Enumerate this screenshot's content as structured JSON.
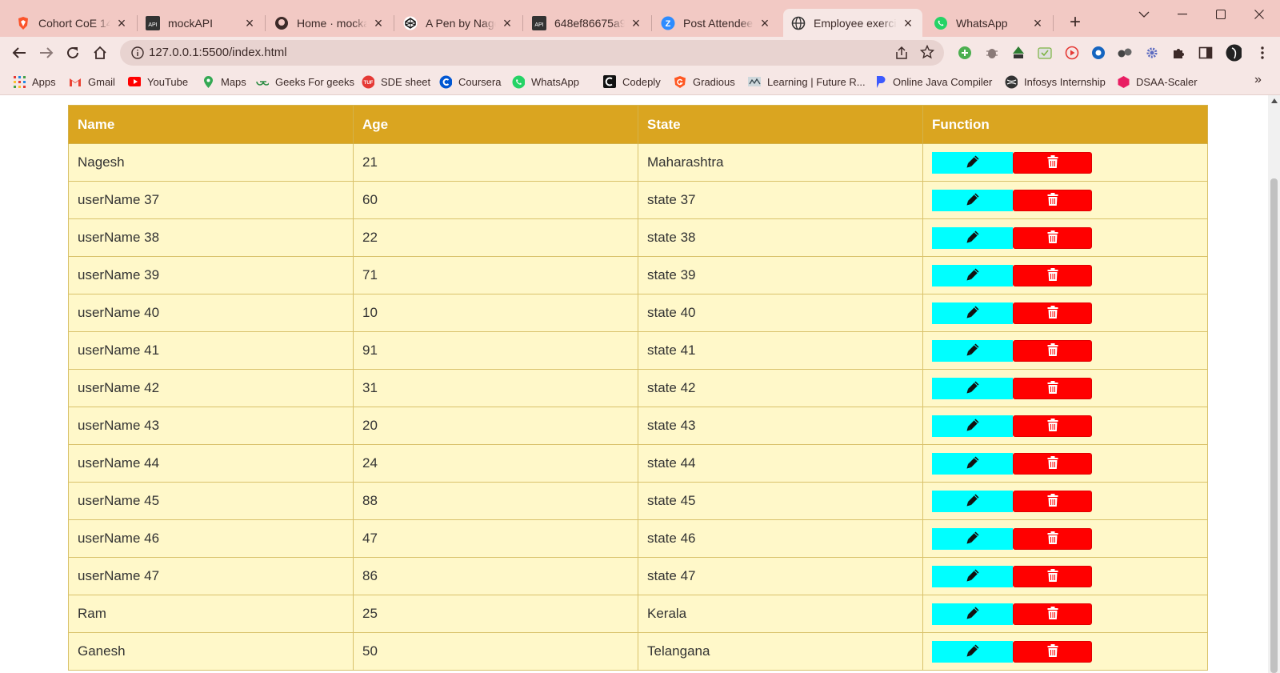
{
  "browser": {
    "tabs": [
      {
        "label": "Cohort CoE 14 - l",
        "icon": "brave-shield-icon",
        "active": false
      },
      {
        "label": "mockAPI",
        "icon": "mockapi-icon",
        "active": false
      },
      {
        "label": "Home · mockapi-",
        "icon": "github-icon",
        "active": false
      },
      {
        "label": "A Pen by Nagesh",
        "icon": "codepen-icon",
        "active": false
      },
      {
        "label": "648ef86675a96b",
        "icon": "mockapi-icon",
        "active": false
      },
      {
        "label": "Post Attendee - Z",
        "icon": "zoom-icon",
        "active": false
      },
      {
        "label": "Employee exercis",
        "icon": "globe-icon",
        "active": true
      },
      {
        "label": "WhatsApp",
        "icon": "whatsapp-icon",
        "active": false
      }
    ],
    "url": "127.0.0.1:5500/index.html",
    "bookmarks": [
      {
        "label": "Apps",
        "icon": "apps-grid-icon"
      },
      {
        "label": "Gmail",
        "icon": "gmail-icon"
      },
      {
        "label": "YouTube",
        "icon": "youtube-icon"
      },
      {
        "label": "Maps",
        "icon": "maps-pin-icon"
      },
      {
        "label": "Geeks For geeks",
        "icon": "gfg-icon"
      },
      {
        "label": "SDE sheet",
        "icon": "tuf-icon"
      },
      {
        "label": "Coursera",
        "icon": "coursera-icon"
      },
      {
        "label": "WhatsApp",
        "icon": "whatsapp-icon"
      },
      {
        "label": "Codeply",
        "icon": "codeply-icon"
      },
      {
        "label": "Gradious",
        "icon": "gradious-icon"
      },
      {
        "label": "Learning | Future R...",
        "icon": "future-skills-icon"
      },
      {
        "label": "Online Java Compiler",
        "icon": "java-compiler-icon"
      },
      {
        "label": "Infosys Internship",
        "icon": "globe-icon"
      },
      {
        "label": "DSAA-Scaler",
        "icon": "scaler-icon"
      }
    ]
  },
  "table": {
    "headers": [
      "Name",
      "Age",
      "State",
      "Function"
    ],
    "rows": [
      {
        "name": "Nagesh",
        "age": "21",
        "state": "Maharashtra"
      },
      {
        "name": "userName 37",
        "age": "60",
        "state": "state 37"
      },
      {
        "name": "userName 38",
        "age": "22",
        "state": "state 38"
      },
      {
        "name": "userName 39",
        "age": "71",
        "state": "state 39"
      },
      {
        "name": "userName 40",
        "age": "10",
        "state": "state 40"
      },
      {
        "name": "userName 41",
        "age": "91",
        "state": "state 41"
      },
      {
        "name": "userName 42",
        "age": "31",
        "state": "state 42"
      },
      {
        "name": "userName 43",
        "age": "20",
        "state": "state 43"
      },
      {
        "name": "userName 44",
        "age": "24",
        "state": "state 44"
      },
      {
        "name": "userName 45",
        "age": "88",
        "state": "state 45"
      },
      {
        "name": "userName 46",
        "age": "47",
        "state": "state 46"
      },
      {
        "name": "userName 47",
        "age": "86",
        "state": "state 47"
      },
      {
        "name": "Ram",
        "age": "25",
        "state": "Kerala"
      },
      {
        "name": "Ganesh",
        "age": "50",
        "state": "Telangana"
      }
    ],
    "edit_icon": "pen-icon",
    "delete_icon": "trash-icon"
  },
  "colors": {
    "header_bg": "#daa520",
    "row_bg": "#fff8c9",
    "edit_button": "#00ffff",
    "delete_button": "#ff0000",
    "tabstrip_bg": "#f2c9c4"
  }
}
